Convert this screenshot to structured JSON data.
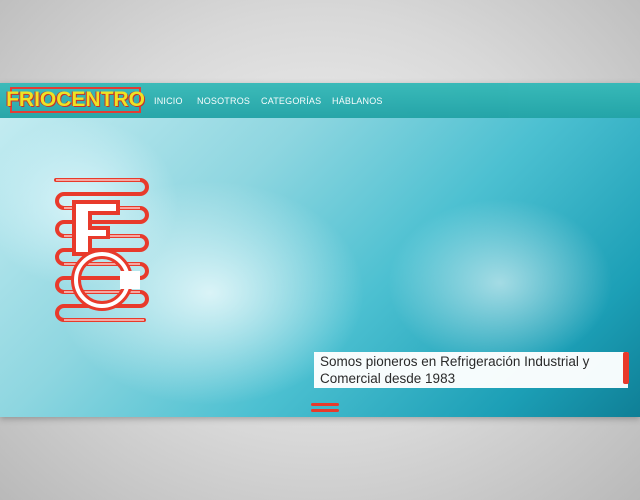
{
  "header": {
    "logo_text": "FRIOCENTRO",
    "nav": [
      {
        "label": "INICIO"
      },
      {
        "label": "NOSOTROS"
      },
      {
        "label": "CATEGORÍAS"
      },
      {
        "label": "HÁBLANOS"
      }
    ]
  },
  "hero": {
    "emblem_letters": "FC",
    "tagline_line1": "Somos pioneros en Refrigeración Industrial y",
    "tagline_line2": "Comercial desde 1983",
    "scroll_icon": "double-line-chevron-icon"
  },
  "colors": {
    "logo_text": "#f2e21a",
    "logo_outline": "#e5342b",
    "navbar": "#2aa9aa",
    "emblem_red": "#e83a2b",
    "accent": "#e83a2b"
  }
}
